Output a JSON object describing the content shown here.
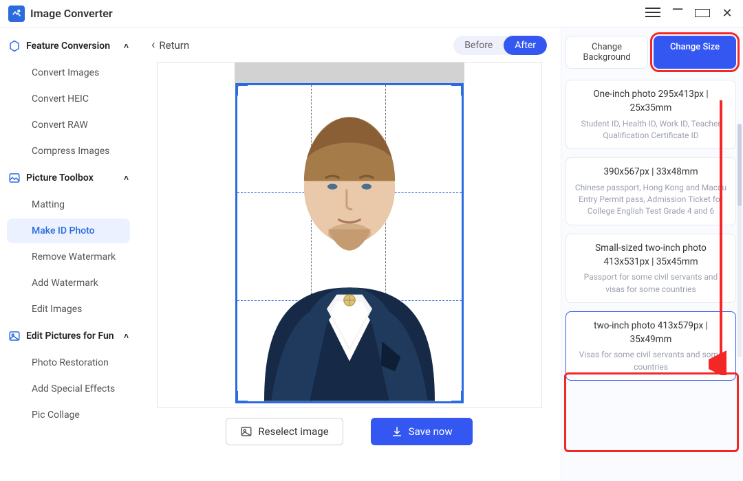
{
  "titlebar": {
    "title": "Image Converter"
  },
  "sidebar": {
    "section_feature": "Feature Conversion",
    "feature_items": [
      "Convert Images",
      "Convert HEIC",
      "Convert RAW",
      "Compress Images"
    ],
    "section_toolbox": "Picture Toolbox",
    "toolbox_items": [
      "Matting",
      "Make ID Photo",
      "Remove Watermark",
      "Add Watermark",
      "Edit Images"
    ],
    "section_fun": "Edit Pictures for Fun",
    "fun_items": [
      "Photo Restoration",
      "Add Special Effects",
      "Pic Collage"
    ],
    "active": "Make ID Photo"
  },
  "main": {
    "return": "Return",
    "before": "Before",
    "after": "After",
    "reselect": "Reselect image",
    "save": "Save now"
  },
  "right": {
    "change_bg": "Change Background",
    "change_size": "Change Size",
    "options": [
      {
        "title": "One-inch photo 295x413px | 25x35mm",
        "desc": "Student ID, Health ID, Work ID, Teacher Qualification Certificate ID"
      },
      {
        "title": "390x567px | 33x48mm",
        "desc": "Chinese passport, Hong Kong and Macau Entry Permit pass, Admission Ticket for College English Test Grade 4 and 6"
      },
      {
        "title": "Small-sized two-inch photo 413x531px | 35x45mm",
        "desc": "Passport for some civil servants and visas for some countries"
      },
      {
        "title": "two-inch photo 413x579px | 35x49mm",
        "desc": "Visas for some civil servants and some countries"
      }
    ],
    "selected_index": 3
  }
}
